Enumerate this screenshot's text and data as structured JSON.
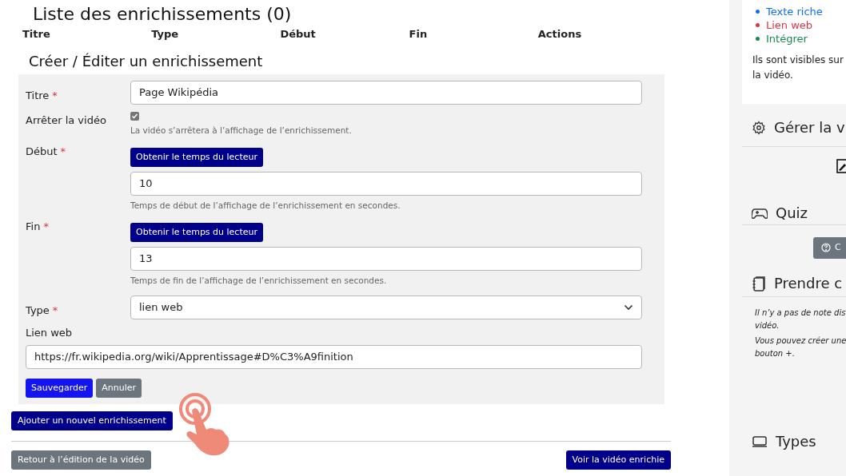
{
  "list_title": "Liste des enrichissements (0)",
  "table": {
    "columns": [
      "Titre",
      "Type",
      "Début",
      "Fin",
      "Actions"
    ]
  },
  "form": {
    "title": "Créer / Éditer un enrichissement",
    "required_mark": "*",
    "fields": [
      {
        "kind": "text",
        "label": "Titre",
        "required": true,
        "value": "Page Wikipédia"
      },
      {
        "kind": "checkbox",
        "label": "Arrêter la vidéo",
        "required": false,
        "checked": true,
        "help": "La vidéo s’arrêtera à l’affichage de l’enrichissement."
      },
      {
        "kind": "time",
        "label": "Début",
        "required": true,
        "button": "Obtenir le temps du lecteur",
        "value": "10",
        "help": "Temps de début de l’affichage de l’enrichissement en secondes."
      },
      {
        "kind": "time",
        "label": "Fin",
        "required": true,
        "button": "Obtenir le temps du lecteur",
        "value": "13",
        "help": "Temps de fin de l’affichage de l’enrichissement en secondes."
      },
      {
        "kind": "select",
        "label": "Type",
        "required": true,
        "value": "lien web"
      },
      {
        "kind": "stacked",
        "label": "Lien web",
        "required": false,
        "value": "https://fr.wikipedia.org/wiki/Apprentissage#D%C3%A9finition"
      }
    ],
    "save": "Sauvegarder",
    "cancel": "Annuler"
  },
  "add_button": "Ajouter un nouvel enrichissement",
  "back_button": "Retour à l’édition de la vidéo",
  "view_button": "Voir la vidéo enrichie",
  "sidebar": {
    "legend": [
      {
        "label": "Texte riche",
        "color": "#0d6efd"
      },
      {
        "label": "Lien web",
        "color": "#dc3545"
      },
      {
        "label": "Intégrer",
        "color": "#198754"
      }
    ],
    "legend_note": [
      "Ils sont visibles sur",
      "la vidéo."
    ],
    "manage_title": "Gérer la v",
    "quiz_title": "Quiz",
    "quiz_button": "C",
    "notes_title": "Prendre c",
    "notes_text": [
      [
        "Il n’y a pas de note dis",
        "vidéo."
      ],
      [
        "Vous pouvez créer une",
        "bouton +."
      ]
    ],
    "types_title": "Types"
  }
}
